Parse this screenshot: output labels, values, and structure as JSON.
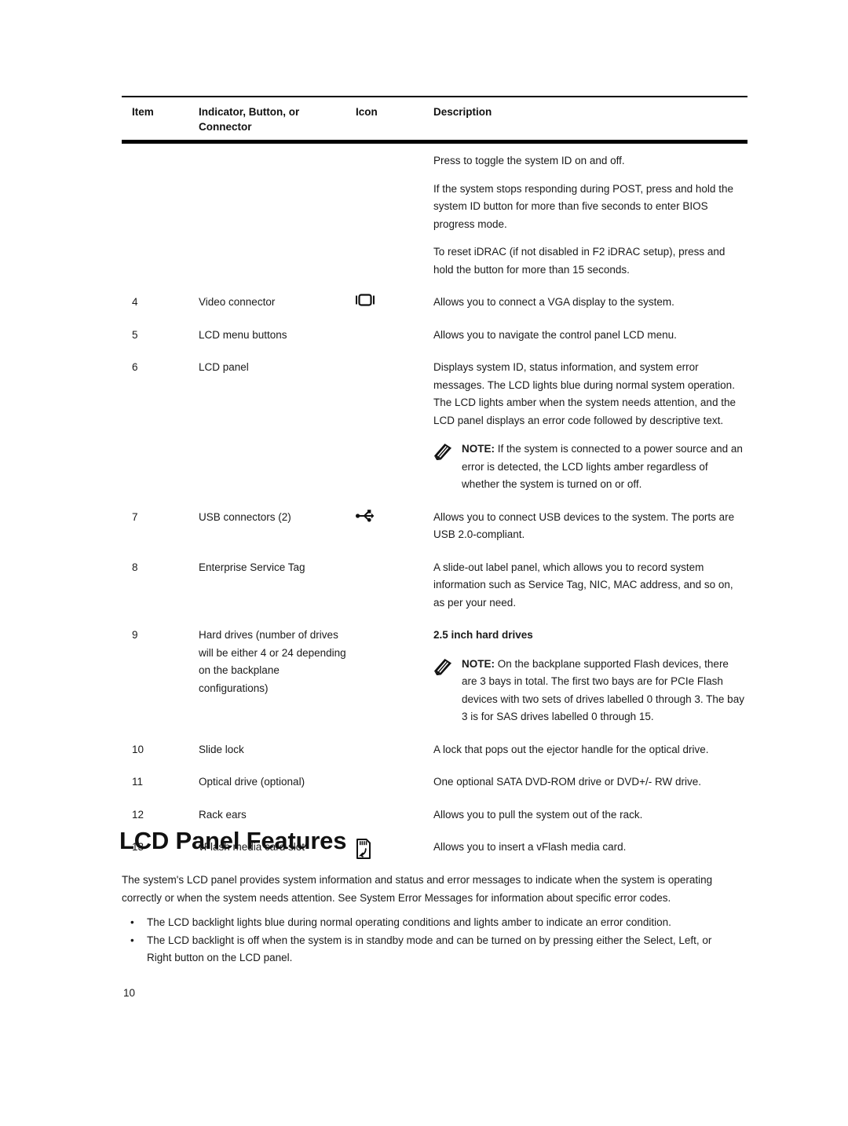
{
  "document": {
    "page_number": "10"
  },
  "table": {
    "headers": {
      "item": "Item",
      "indicator": "Indicator, Button, or Connector",
      "icon": "Icon",
      "description": "Description"
    },
    "rows": [
      {
        "item": "",
        "indicator": "",
        "icon": "",
        "description_paragraphs": [
          "Press to toggle the system ID on and off.",
          "If the system stops responding during POST, press and hold the system ID button for more than five seconds to enter BIOS progress mode.",
          "To reset iDRAC (if not disabled in F2 iDRAC setup), press and hold the button for more than 15 seconds."
        ]
      },
      {
        "item": "4",
        "indicator": "Video connector",
        "icon": "vga-connector-icon",
        "description_paragraphs": [
          "Allows you to connect a VGA display to the system."
        ]
      },
      {
        "item": "5",
        "indicator": "LCD menu buttons",
        "icon": "",
        "description_paragraphs": [
          "Allows you to navigate the control panel LCD menu."
        ]
      },
      {
        "item": "6",
        "indicator": "LCD panel",
        "icon": "",
        "description_paragraphs": [
          "Displays system ID, status information, and system error messages. The LCD lights blue during normal system operation. The LCD lights amber when the system needs attention, and the LCD panel displays an error code followed by descriptive text."
        ],
        "note": {
          "label": "NOTE:",
          "text": "If the system is connected to a power source and an error is detected, the LCD lights amber regardless of whether the system is turned on or off."
        }
      },
      {
        "item": "7",
        "indicator": "USB connectors (2)",
        "icon": "usb-icon",
        "description_paragraphs": [
          "Allows you to connect USB devices to the system. The ports are USB 2.0-compliant."
        ]
      },
      {
        "item": "8",
        "indicator": "Enterprise Service Tag",
        "icon": "",
        "description_paragraphs": [
          "A slide-out label panel, which allows you to record system information such as Service Tag, NIC, MAC address, and so on, as per your need."
        ]
      },
      {
        "item": "9",
        "indicator": "Hard drives (number of drives will be either 4 or 24 depending on the backplane configurations)",
        "icon": "",
        "description_heading": "2.5 inch hard drives",
        "description_paragraphs": [],
        "note": {
          "label": "NOTE:",
          "text": "On the backplane supported Flash devices, there are 3 bays in total. The first two bays are for PCIe Flash devices with two sets of drives labelled 0 through 3. The bay 3 is for SAS drives labelled 0 through 15."
        }
      },
      {
        "item": "10",
        "indicator": "Slide lock",
        "icon": "",
        "description_paragraphs": [
          "A lock that pops out the ejector handle for the optical drive."
        ]
      },
      {
        "item": "11",
        "indicator": "Optical drive (optional)",
        "icon": "",
        "description_paragraphs": [
          "One optional SATA DVD-ROM drive or DVD+/- RW drive."
        ]
      },
      {
        "item": "12",
        "indicator": "Rack ears",
        "icon": "",
        "description_paragraphs": [
          "Allows you to pull the system out of the rack."
        ]
      },
      {
        "item": "13",
        "indicator": "vFlash media card slot",
        "icon": "vflash-media-card-icon",
        "description_paragraphs": [
          "Allows you to insert a vFlash media card."
        ]
      }
    ]
  },
  "section": {
    "heading": "LCD Panel Features",
    "intro": "The system's LCD panel provides system information and status and error messages to indicate when the system is operating correctly or when the system needs attention. See System Error Messages for information about specific error codes.",
    "bullets": [
      "The LCD backlight lights blue during normal operating conditions and lights amber to indicate an error condition.",
      "The LCD backlight is off when the system is in standby mode and can be turned on by pressing either the Select, Left, or Right button on the LCD panel."
    ]
  },
  "colors": {
    "text": "#1a1a1a",
    "rule": "#000000",
    "background": "#ffffff"
  }
}
